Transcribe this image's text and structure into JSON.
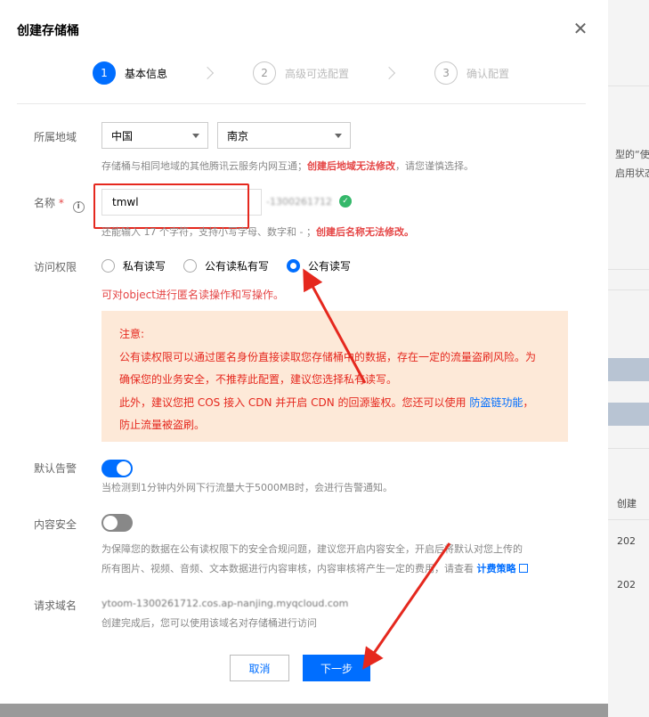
{
  "modal": {
    "title": "创建存储桶",
    "close_label": "✕"
  },
  "steps": [
    {
      "num": "1",
      "label": "基本信息",
      "active": true
    },
    {
      "num": "2",
      "label": "高级可选配置",
      "active": false
    },
    {
      "num": "3",
      "label": "确认配置",
      "active": false
    }
  ],
  "region": {
    "label": "所属地域",
    "country": "中国",
    "city": "南京",
    "hint_prefix": "存储桶与相同地域的其他腾讯云服务内网互通；",
    "hint_warn": "创建后地域无法修改",
    "hint_suffix": "，请您谨慎选择。"
  },
  "name": {
    "label": "名称",
    "required_mark": "*",
    "info_icon": "i",
    "value": "tmwl",
    "suffix": "-1300261712",
    "ok_icon": "✓",
    "hint_prefix": "还能输入 17 个字符，支持小写字母、数字和 - ；",
    "hint_warn": "创建后名称无法修改。"
  },
  "access": {
    "label": "访问权限",
    "options": [
      "私有读写",
      "公有读私有写",
      "公有读写"
    ],
    "selected_index": 2,
    "red_text": "可对object进行匿名读操作和写操作。"
  },
  "notice": {
    "line1": "注意:",
    "line2": "公有读权限可以通过匿名身份直接读取您存储桶中的数据，存在一定的流量盗刷风险。为",
    "line3": "确保您的业务安全，不推荐此配置，建议您选择私有读写。",
    "line4_prefix": "此外，建议您把 COS 接入 CDN 并开启 CDN 的回源鉴权。您还可以使用 ",
    "line4_link": "防盗链功能",
    "line4_suffix": "，",
    "line5": "防止流量被盗刷。"
  },
  "alarm": {
    "label": "默认告警",
    "on": true,
    "desc": "当检测到1分钟内外网下行流量大于5000MB时，会进行告警通知。"
  },
  "content_security": {
    "label": "内容安全",
    "on": false,
    "line1": "为保障您的数据在公有读权限下的安全合规问题，建议您开启内容安全，开启后将默认对您上传的",
    "line2_prefix": "所有图片、视频、音频、文本数据进行内容审核，内容审核将产生一定的费用，请查看 ",
    "line2_link": "计费策略"
  },
  "request_domain": {
    "label": "请求域名",
    "value": "ytoom-1300261712.cos.ap-nanjing.myqcloud.com",
    "desc": "创建完成后，您可以使用该域名对存储桶进行访问"
  },
  "buttons": {
    "cancel": "取消",
    "next": "下一步"
  },
  "background": {
    "text1": "型的“使",
    "text2": "启用状态，",
    "col_header": "创建",
    "row1": "202",
    "row2": "202"
  },
  "colors": {
    "primary": "#006eff",
    "danger": "#e54545",
    "annotation": "#e5281e",
    "notice_bg": "#fde9d8"
  }
}
